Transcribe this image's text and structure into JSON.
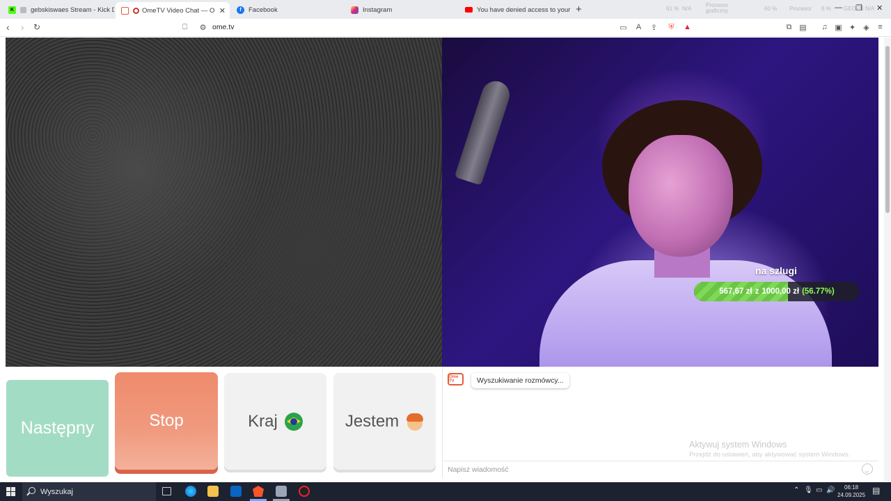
{
  "browser": {
    "tabs": [
      {
        "label": "gebskiswaes Stream - Kick Dashb",
        "favicon": "kick-icon",
        "color": "#53fc18"
      },
      {
        "label": "OmeTV Video Chat — Omeg",
        "favicon": "ometv-icon",
        "color": "#e45b3a",
        "active": true
      },
      {
        "label": "Facebook",
        "favicon": "facebook-icon",
        "color": "#1877f2"
      },
      {
        "label": "Instagram",
        "favicon": "instagram-icon",
        "color": "#d62976"
      },
      {
        "label": "You have denied access to your devi",
        "favicon": "youtube-icon",
        "color": "#ff0000"
      }
    ],
    "new_tab": "+",
    "url": "ome.tv",
    "sys_monitor": [
      "61 %",
      "N/A",
      "Procesor graficzny",
      "60 %",
      "Procesor",
      "8 %",
      "GEOFN",
      "N/A"
    ]
  },
  "video": {
    "goal": {
      "title": "na szlugi",
      "current": "567,67 zł",
      "separator": "z",
      "target": "1000,00 zł",
      "percent_label": "(56.77%)",
      "fraction": 0.5677
    }
  },
  "controls": {
    "next_label": "Następny",
    "stop_label": "Stop",
    "country_label": "Kraj",
    "gender_label": "Jestem"
  },
  "chat": {
    "logo_text": "Ome TV",
    "status": "Wyszukiwanie rozmówcy...",
    "watermark_title": "Aktywuj system Windows",
    "watermark_sub": "Przejdź do ustawień, aby aktywować system Windows.",
    "input_placeholder": "Napisz wiadomość"
  },
  "taskbar": {
    "search_label": "Wyszukaj",
    "time": "06:18",
    "date": "24.09.2025"
  },
  "colors": {
    "next": "#a3dcc4",
    "stop": "#ef8a6c",
    "goal_fill": "#7ed957",
    "goal_percent": "#8cff5a"
  }
}
